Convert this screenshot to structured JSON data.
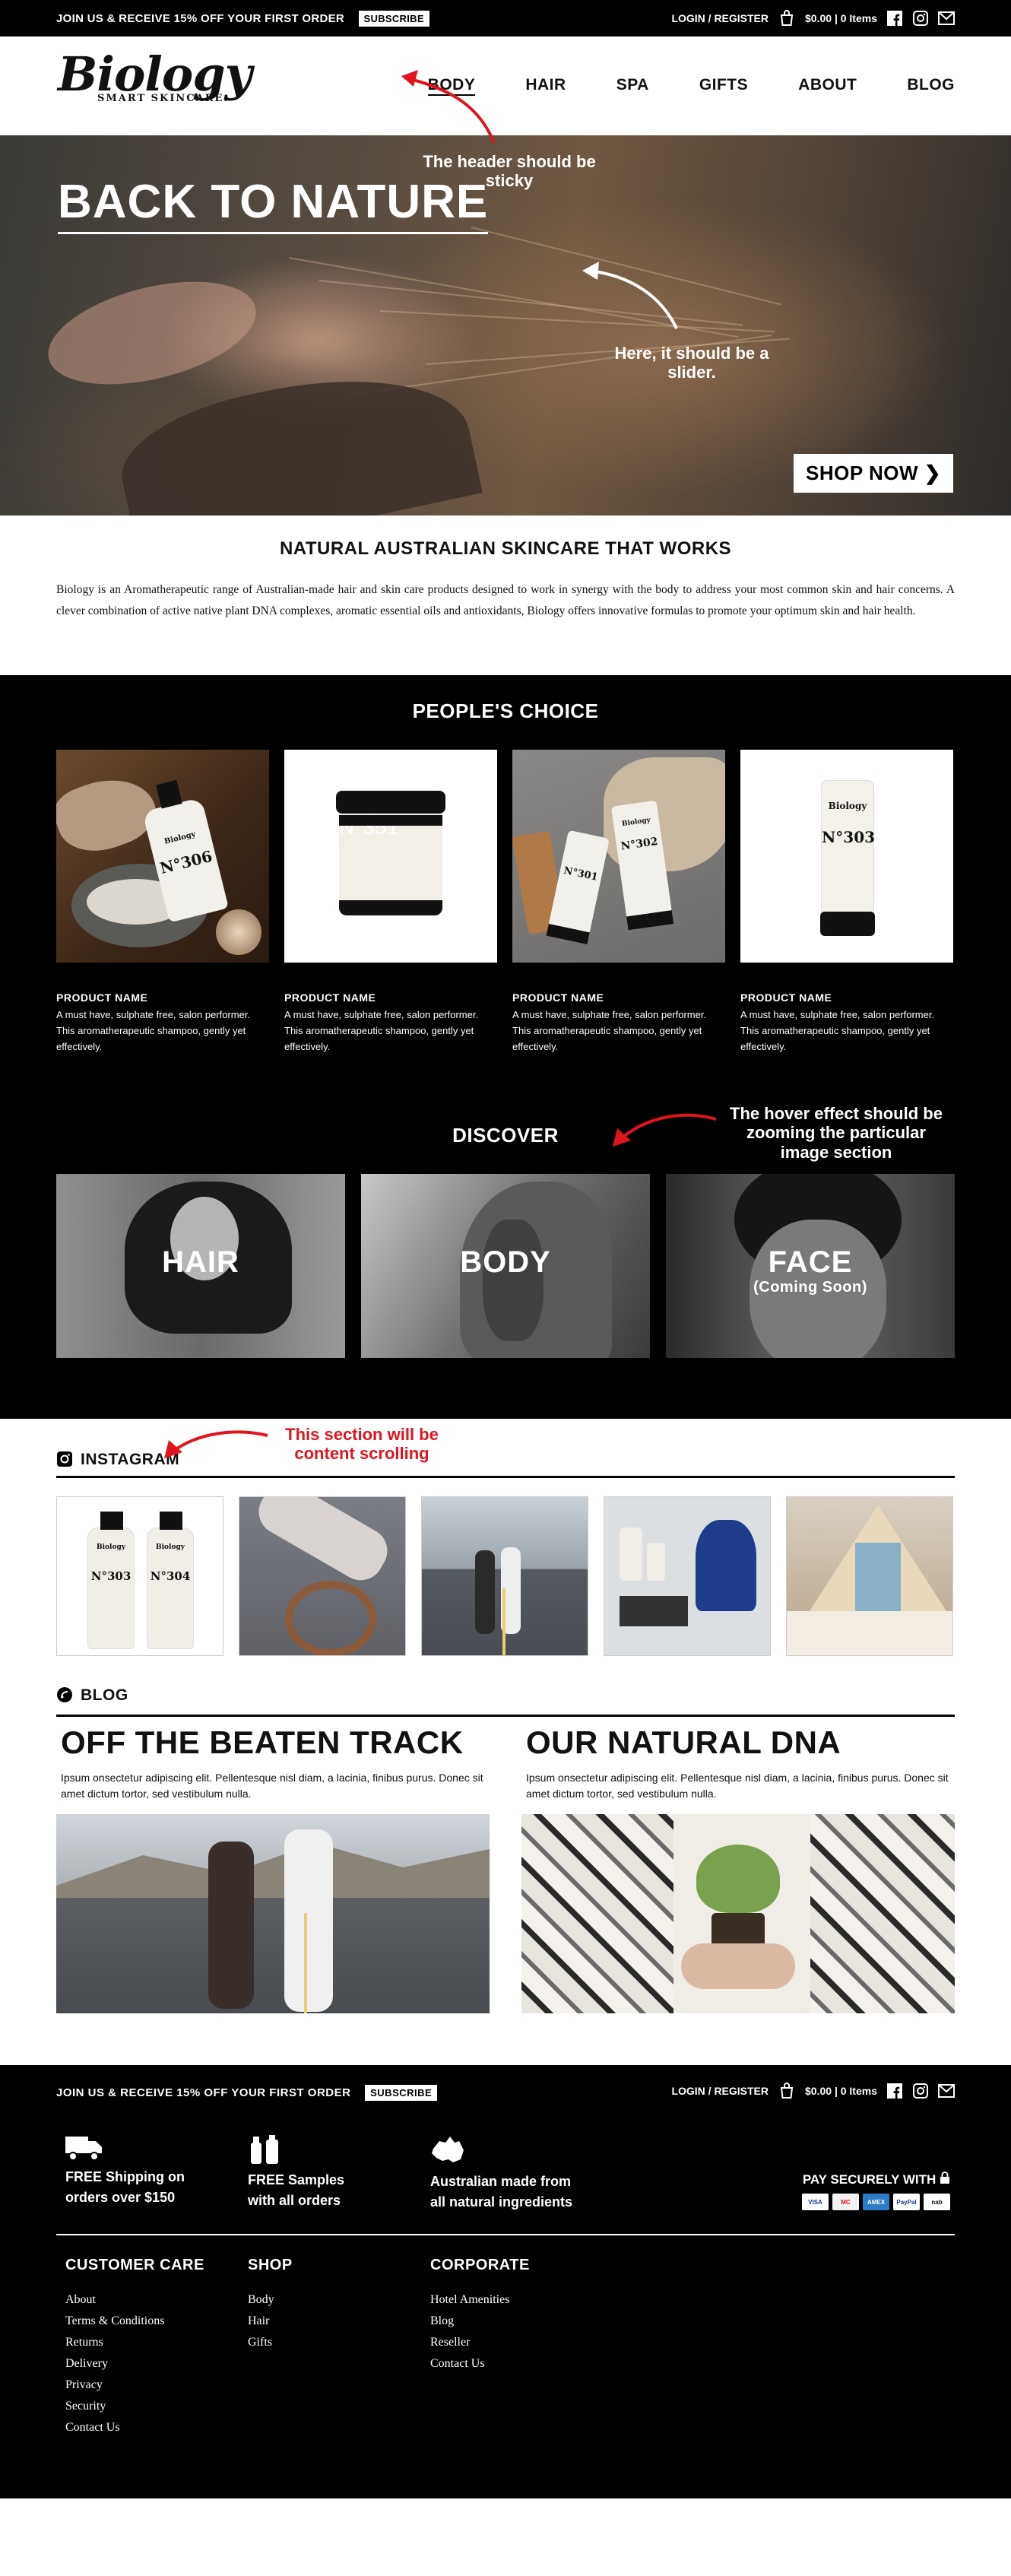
{
  "topbar": {
    "promo": "JOIN US & RECEIVE 15% OFF YOUR FIRST ORDER",
    "subscribe": "SUBSCRIBE",
    "login": "LOGIN / REGISTER",
    "cart": "$0.00 | 0 Items"
  },
  "header": {
    "logo": "Biology",
    "tagline": "SMART SKINCARE.",
    "nav": [
      "BODY",
      "HAIR",
      "SPA",
      "GIFTS",
      "ABOUT",
      "BLOG"
    ]
  },
  "annotations": {
    "sticky": "The header should be sticky",
    "slider": "Here, it should be a slider.",
    "hover": "The hover effect should be zooming the particular image section",
    "scroll": "This section will be content scrolling"
  },
  "hero": {
    "title": "BACK TO NATURE",
    "cta": "SHOP NOW ❯"
  },
  "intro": {
    "heading": "NATURAL AUSTRALIAN SKINCARE THAT WORKS",
    "body": "Biology is an Aromatherapeutic range of Australian-made hair and skin care products designed to work in synergy with the body to address your most common skin and hair concerns. A clever combination of active native plant DNA complexes, aromatic essential oils and antioxidants, Biology offers innovative formulas to promote your optimum skin and hair health."
  },
  "peoples_choice": {
    "title": "PEOPLE'S CHOICE",
    "products": [
      {
        "name": "PRODUCT NAME",
        "desc": "A must have, sulphate free, salon performer. This aromatherapeutic shampoo, gently yet effectively.",
        "label": "N°306"
      },
      {
        "name": "PRODUCT NAME",
        "desc": "A must have, sulphate free, salon performer. This aromatherapeutic shampoo, gently yet effectively.",
        "label": "N°351"
      },
      {
        "name": "PRODUCT NAME",
        "desc": "A must have, sulphate free, salon performer. This aromatherapeutic shampoo, gently yet effectively.",
        "label": "N°302"
      },
      {
        "name": "PRODUCT NAME",
        "desc": "A must have, sulphate free, salon performer. This aromatherapeutic shampoo, gently yet effectively.",
        "label": "N°303"
      }
    ]
  },
  "discover": {
    "title": "DISCOVER",
    "tiles": [
      {
        "label": "HAIR",
        "sub": ""
      },
      {
        "label": "BODY",
        "sub": ""
      },
      {
        "label": "FACE",
        "sub": "(Coming Soon)"
      }
    ]
  },
  "instagram": {
    "title": "INSTAGRAM",
    "bottle_labels": [
      "N°303",
      "N°304"
    ]
  },
  "blog": {
    "title": "BLOG",
    "posts": [
      {
        "title": "OFF THE BEATEN TRACK",
        "excerpt": "Ipsum onsectetur adipiscing elit. Pellentesque nisl diam, a lacinia, finibus purus. Donec sit amet dictum tortor, sed vestibulum nulla."
      },
      {
        "title": "OUR NATURAL DNA",
        "excerpt": "Ipsum onsectetur adipiscing elit. Pellentesque nisl diam, a lacinia, finibus purus. Donec sit amet dictum tortor, sed vestibulum nulla."
      }
    ]
  },
  "footer": {
    "promo": "JOIN US & RECEIVE 15% OFF YOUR FIRST ORDER",
    "subscribe": "SUBSCRIBE",
    "login": "LOGIN / REGISTER",
    "cart": "$0.00 | 0 Items",
    "features": [
      {
        "line1": "FREE Shipping on",
        "line2": "orders over $150",
        "icon": "truck-icon"
      },
      {
        "line1": "FREE Samples",
        "line2": "with all orders",
        "icon": "bottles-icon"
      },
      {
        "line1": "Australian made from",
        "line2": "all natural ingredients",
        "icon": "australia-icon"
      }
    ],
    "pay": "PAY SECURELY WITH",
    "cards": [
      "VISA",
      "MC",
      "AMEX",
      "PayPal",
      "nab"
    ],
    "columns": [
      {
        "title": "CUSTOMER CARE",
        "links": [
          "About",
          "Terms & Conditions",
          "Returns",
          "Delivery",
          "Privacy",
          "Security",
          "Contact Us"
        ]
      },
      {
        "title": "SHOP",
        "links": [
          "Body",
          "Hair",
          "Gifts"
        ]
      },
      {
        "title": "CORPORATE",
        "links": [
          "Hotel Amenities",
          "Blog",
          "Reseller",
          "Contact Us"
        ]
      }
    ]
  },
  "colors": {
    "annotation_dark": "#ffffff",
    "annotation_red": "#e0141e",
    "arrow_red": "#e0141e"
  }
}
